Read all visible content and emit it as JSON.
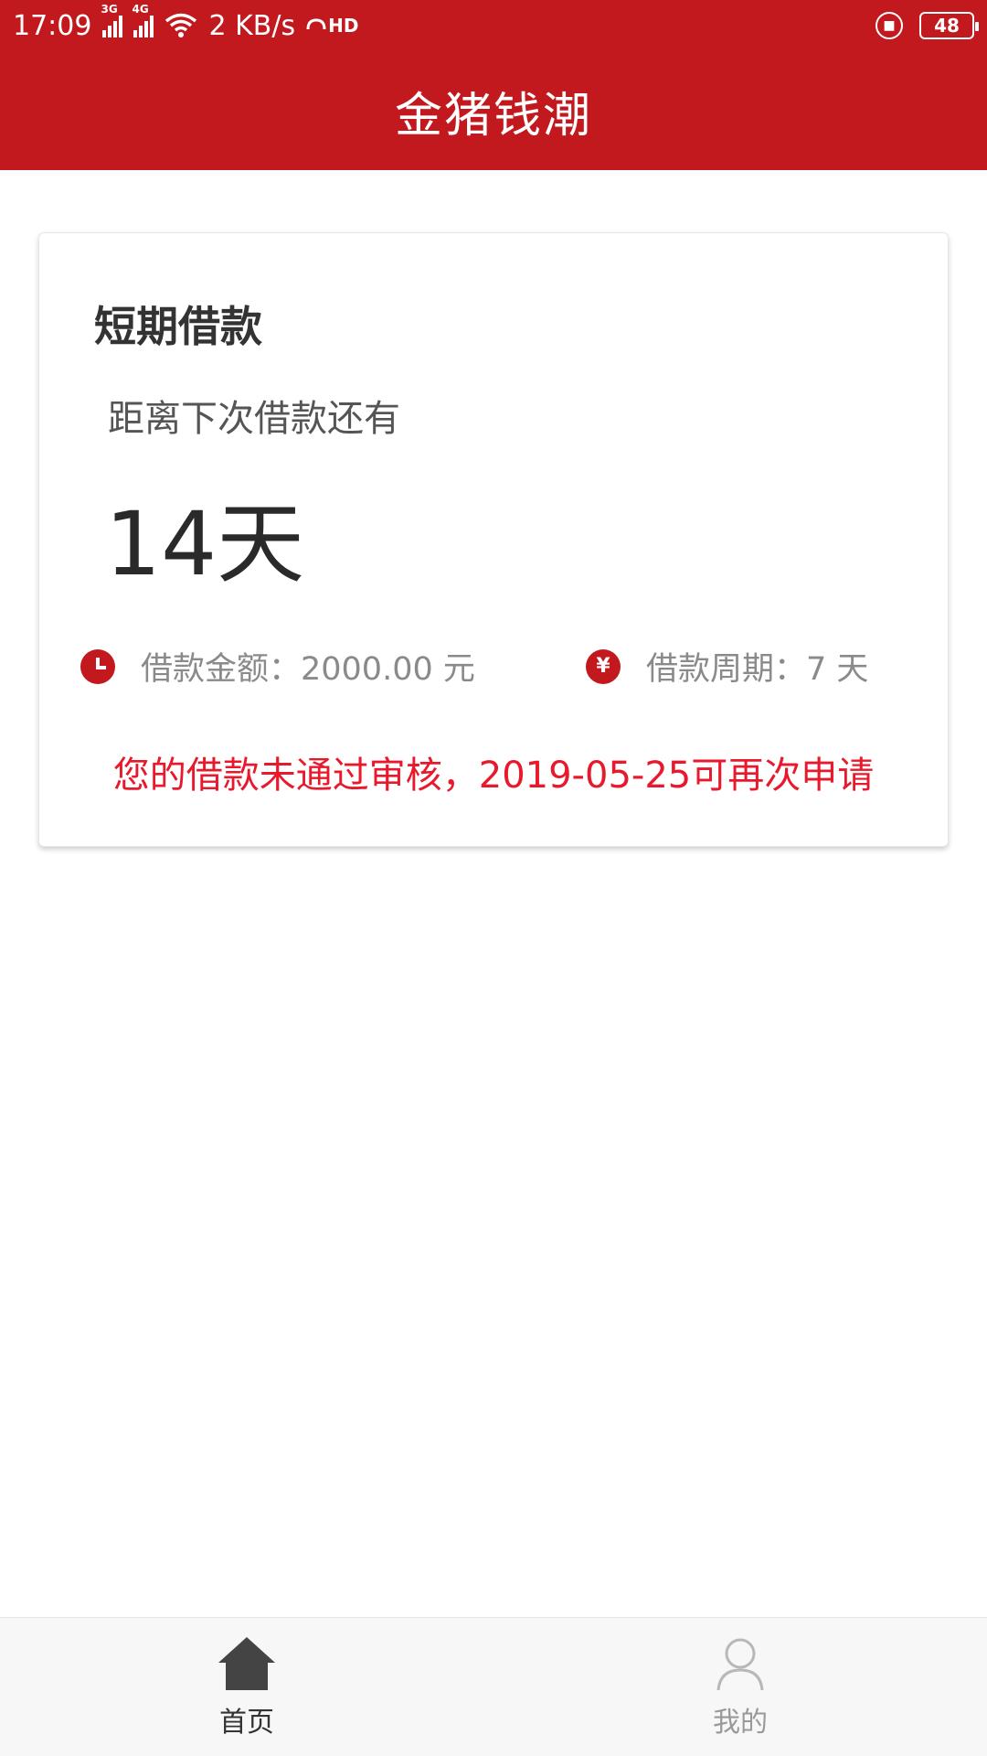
{
  "status_bar": {
    "time": "17:09",
    "sim1_network": "3G",
    "sim2_network": "4G",
    "speed": "2 KB/s",
    "hd_label": "HD",
    "battery": "48"
  },
  "app_bar": {
    "title": "金猪钱潮"
  },
  "loan_card": {
    "title": "短期借款",
    "countdown_label": "距离下次借款还有",
    "countdown_value": "14天",
    "amount_text": "借款金额：2000.00 元",
    "period_text": "借款周期：7 天",
    "period_icon_glyph": "¥",
    "notice": "您的借款未通过审核，2019-05-25可再次申请"
  },
  "tab_bar": {
    "tabs": [
      {
        "label": "首页",
        "icon": "home-icon",
        "active": true
      },
      {
        "label": "我的",
        "icon": "user-icon",
        "active": false
      }
    ]
  },
  "colors": {
    "brand": "#c2191f",
    "warning": "#e8192c"
  }
}
